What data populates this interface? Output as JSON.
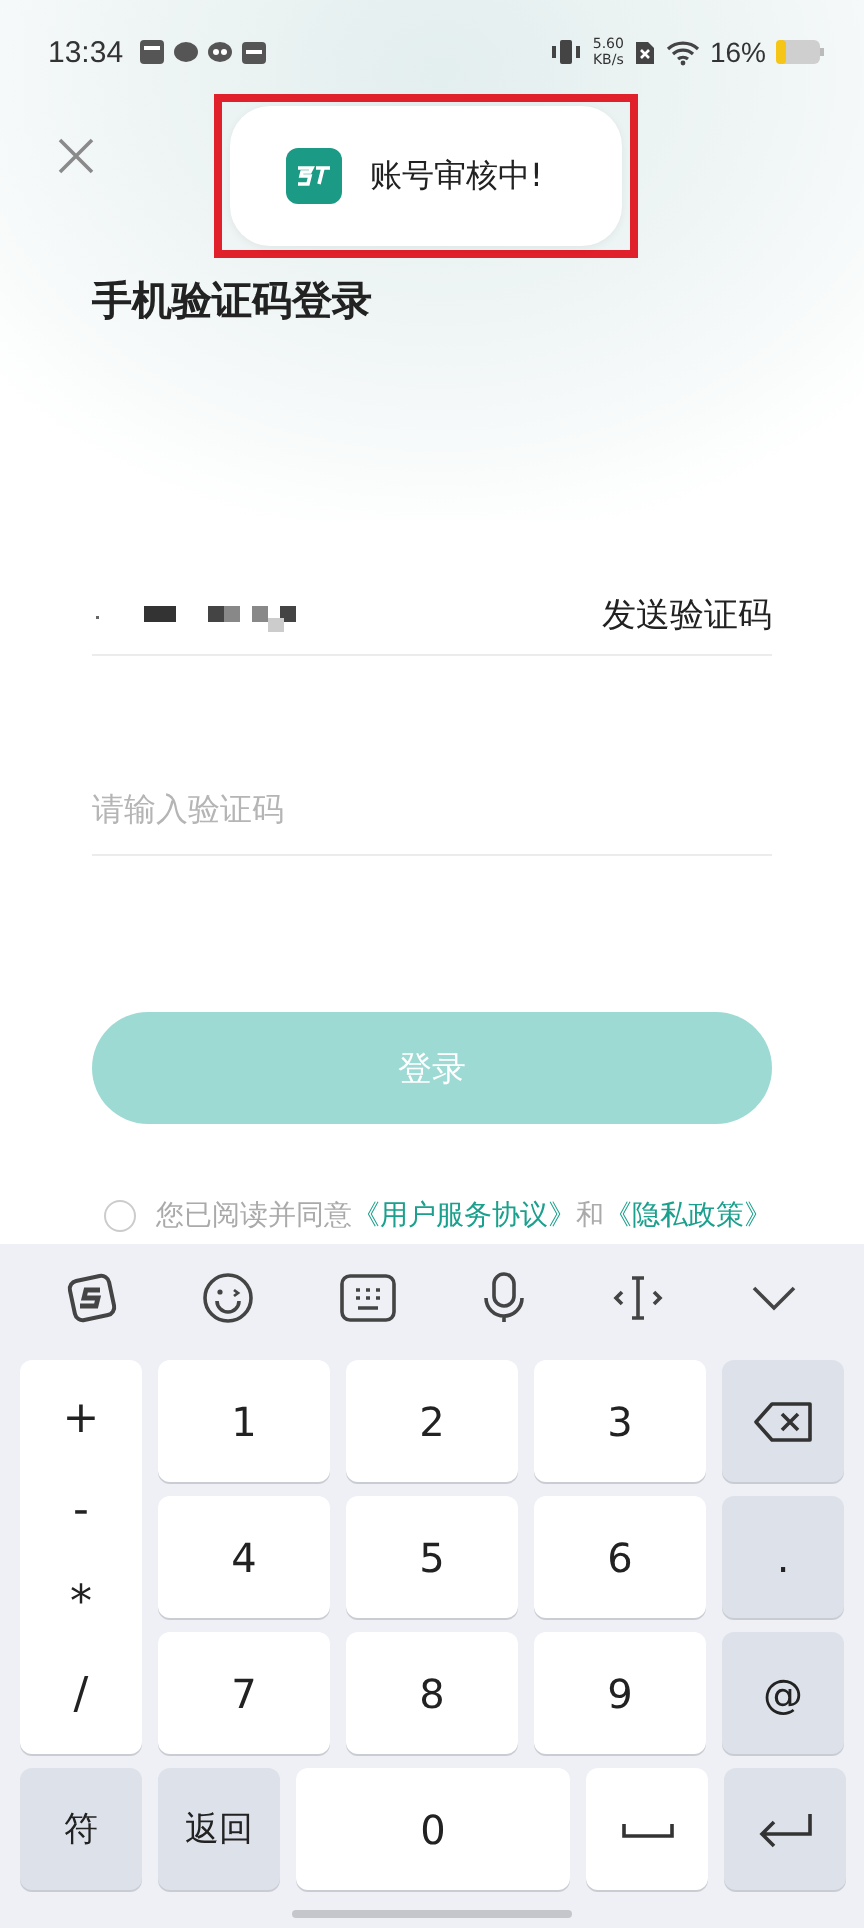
{
  "status_bar": {
    "time": "13:34",
    "net_speed_value": "5.60",
    "net_speed_unit": "KB/s",
    "battery": "16%"
  },
  "toast": {
    "message": "账号审核中!",
    "highlighted": true
  },
  "title": "手机验证码登录",
  "phone_field": {
    "send_code": "发送验证码"
  },
  "code_field": {
    "placeholder": "请输入验证码"
  },
  "login_button": {
    "label": "登录",
    "disabled": true
  },
  "agreement": {
    "checked": false,
    "text": "您已阅读并同意",
    "link1": "《用户服务协议》",
    "joiner": "和",
    "link2": "《隐私政策》"
  },
  "keyboard": {
    "symbols": [
      "+",
      "-",
      "*",
      "/"
    ],
    "rows": [
      [
        "1",
        "2",
        "3"
      ],
      [
        "4",
        "5",
        "6"
      ],
      [
        "7",
        "8",
        "9"
      ]
    ],
    "right_keys": [
      {
        "kind": "backspace"
      },
      {
        "kind": "text",
        "label": "."
      },
      {
        "kind": "text",
        "label": "@"
      }
    ],
    "bottom": [
      {
        "kind": "text",
        "label": "符"
      },
      {
        "kind": "text",
        "label": "返回"
      },
      {
        "kind": "wide",
        "label": "0"
      },
      {
        "kind": "space"
      },
      {
        "kind": "enter"
      }
    ]
  }
}
